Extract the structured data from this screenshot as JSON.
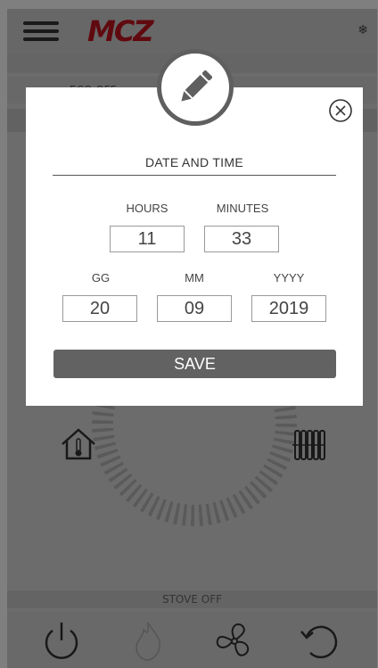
{
  "header": {
    "logo_text": "MCZ",
    "snow_icon": "❄"
  },
  "background": {
    "status_text": "STOVE OFF",
    "eco_label": "ECO OFF"
  },
  "dialog": {
    "title": "DATE AND TIME",
    "hours_label": "HOURS",
    "minutes_label": "MINUTES",
    "hours_value": "11",
    "minutes_value": "33",
    "day_label": "GG",
    "month_label": "MM",
    "year_label": "YYYY",
    "day_value": "20",
    "month_value": "09",
    "year_value": "2019",
    "save_label": "SAVE"
  },
  "colors": {
    "brand": "#c0121f",
    "button": "#626262",
    "overlay": "rgba(0,0,0,0.5)"
  },
  "icons": [
    "menu-icon",
    "snowflake-icon",
    "pencil-icon",
    "close-icon",
    "home-thermometer-icon",
    "radiator-icon",
    "power-icon",
    "flame-icon",
    "fan-icon",
    "refresh-icon"
  ]
}
